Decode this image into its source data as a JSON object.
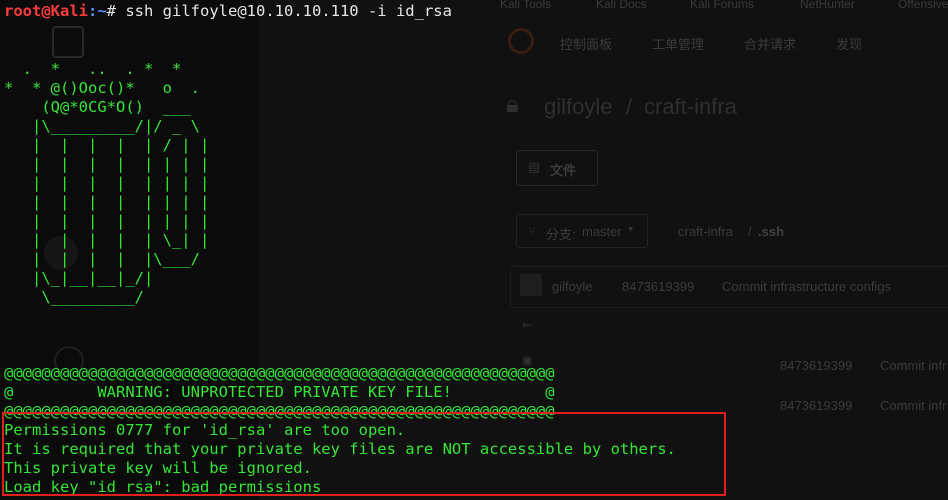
{
  "background": {
    "tabs": [
      "Kali Tools",
      "Kali Docs",
      "Kali Forums",
      "NetHunter",
      "Offensive"
    ],
    "nav": [
      "控制面板",
      "工单管理",
      "合并请求",
      "发现"
    ],
    "repo_owner": "gilfoyle",
    "repo_separator": "/",
    "repo_name": "craft-infra",
    "files_tab": "文件",
    "branch_label": "分支:",
    "branch_name": "master",
    "path_root": "craft-infra",
    "path_sep": "/",
    "path_dir": ".ssh",
    "commit_author": "gilfoyle",
    "commit_hash": "8473619399",
    "commit_message": "Commit infrastructure configs",
    "rows": [
      {
        "hash": "8473619399",
        "message": "Commit infr"
      },
      {
        "hash": "8473619399",
        "message": "Commit infr"
      }
    ]
  },
  "terminal": {
    "prompt_user": "root@Kali",
    "prompt_path": ":~",
    "prompt_symbol": "#",
    "command": " ssh gilfoyle@10.10.10.110 -i id_rsa",
    "ascii_art": [
      "  .  *   ..  . *  *",
      "*  * @()Ooc()*   o  .",
      "    (Q@*0CG*O()  ___",
      "   |\\_________/|/ _ \\",
      "   |  |  |  |  | / | |",
      "   |  |  |  |  | | | |",
      "   |  |  |  |  | | | |",
      "   |  |  |  |  | | | |",
      "   |  |  |  |  | | | |",
      "   |  |  |  |  | \\_| |",
      "   |  |  |  |  |\\___/",
      "   |\\_|__|__|_/|",
      "    \\_________/"
    ],
    "warning_border": "@@@@@@@@@@@@@@@@@@@@@@@@@@@@@@@@@@@@@@@@@@@@@@@@@@@@@@@@@@@",
    "warning_text": "@         WARNING: UNPROTECTED PRIVATE KEY FILE!          @",
    "error_lines": [
      "Permissions 0777 for 'id_rsa' are too open.",
      "It is required that your private key files are NOT accessible by others.",
      "This private key will be ignored.",
      "Load key \"id_rsa\": bad permissions"
    ]
  },
  "colors": {
    "terminal_text": "#33e633",
    "prompt_user": "#ff3b3b",
    "prompt_path": "#5b8cff",
    "highlight_box": "#e0201d"
  }
}
